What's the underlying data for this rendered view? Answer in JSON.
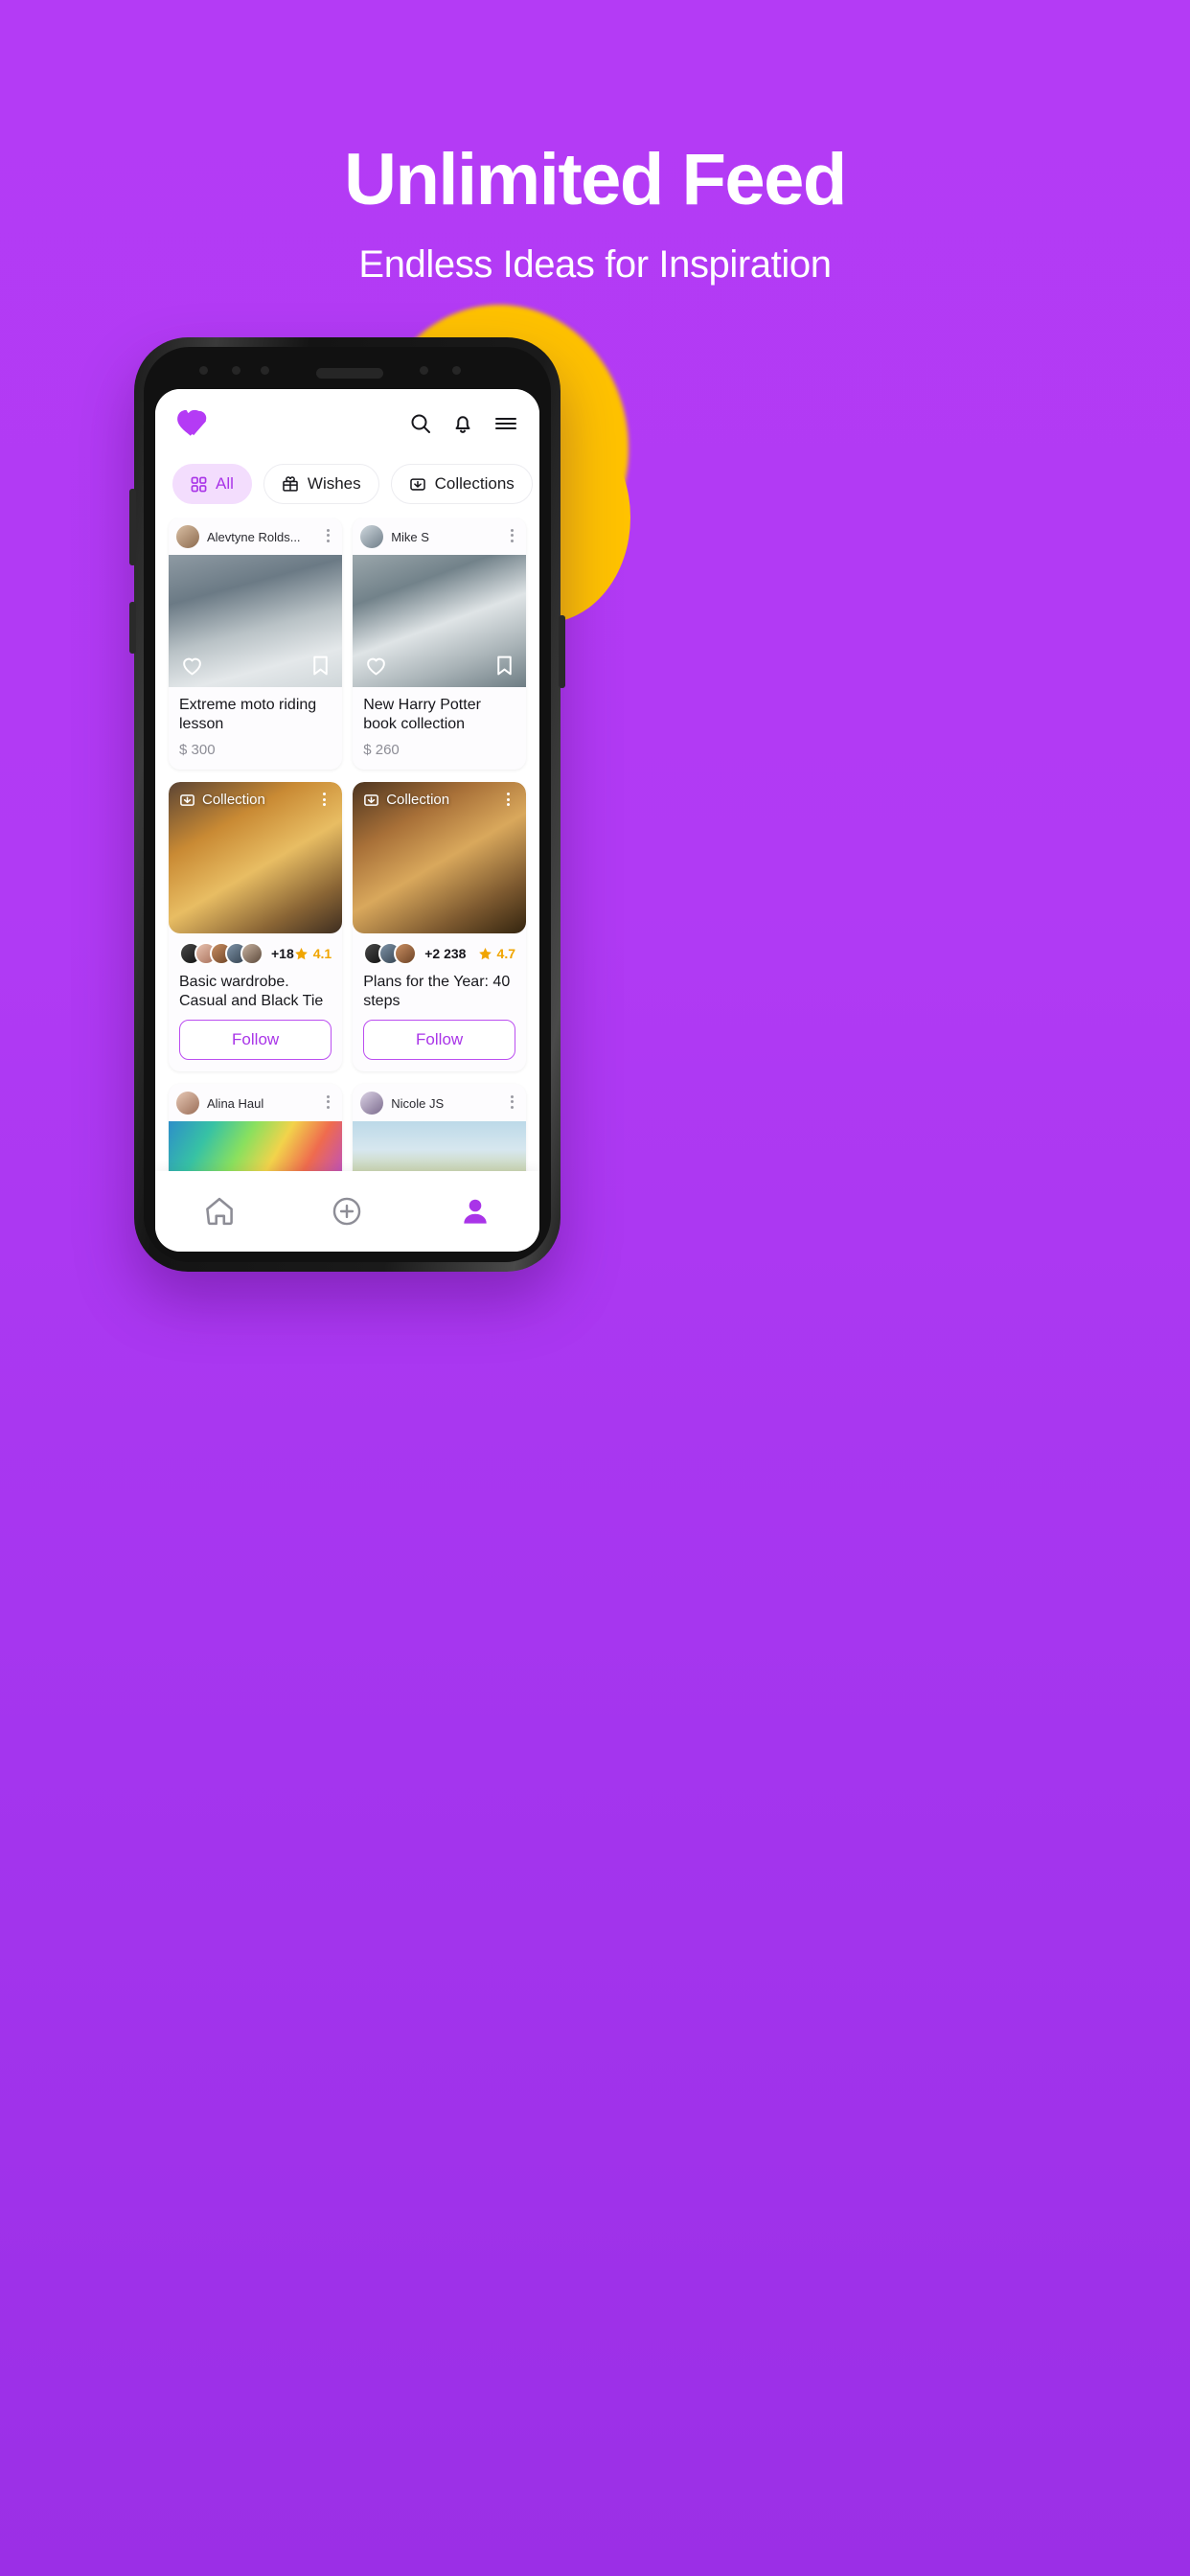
{
  "hero": {
    "title": "Unlimited Feed",
    "subtitle": "Endless Ideas for Inspiration"
  },
  "colors": {
    "background_top": "#b43bf5",
    "background_bottom": "#9b2fe6",
    "accent": "#a934e8",
    "chip_active_bg": "#f3ddfd",
    "blob": "#ffc200",
    "star": "#f0a500",
    "follow_border": "#bb4ef0"
  },
  "app": {
    "header": {
      "logo": "heart-logo",
      "icons": [
        "search-icon",
        "bell-icon",
        "menu-icon"
      ]
    },
    "chips": [
      {
        "label": "All",
        "icon": "grid-icon",
        "active": true
      },
      {
        "label": "Wishes",
        "icon": "gift-icon",
        "active": false
      },
      {
        "label": "Collections",
        "icon": "collection-icon",
        "active": false
      }
    ],
    "feed": {
      "left_column": [
        {
          "type": "post",
          "user": "Alevtyne Rolds...",
          "title": "Extreme moto riding lesson",
          "price": "$ 300",
          "media": "moto-rider-photo",
          "actions": [
            "heart-icon",
            "bookmark-icon"
          ],
          "menu": "more-options-icon"
        },
        {
          "type": "collection",
          "badge": "Collection",
          "badge_icon": "collection-icon",
          "title": "Basic wardrobe. Casual and Black Tie",
          "participants_extra": "+18",
          "rating": "4.1",
          "follow_label": "Follow",
          "media": "man-yellow-hoodie-photo",
          "menu": "more-options-icon"
        },
        {
          "type": "post",
          "user": "Alina Haul",
          "media": "colorful-abstract-photo",
          "menu": "more-options-icon"
        }
      ],
      "right_column": [
        {
          "type": "post",
          "user": "Mike S",
          "title": "New Harry Potter book collection",
          "price": "$ 260",
          "media": "steam-train-viaduct-photo",
          "actions": [
            "heart-icon",
            "bookmark-icon"
          ],
          "menu": "more-options-icon"
        },
        {
          "type": "collection",
          "badge": "Collection",
          "badge_icon": "collection-icon",
          "title": "Plans for the Year: 40 steps",
          "participants_extra": "+2 238",
          "rating": "4.7",
          "follow_label": "Follow",
          "media": "echidna-photo",
          "menu": "more-options-icon"
        },
        {
          "type": "post",
          "user": "Nicole JS",
          "media": "sky-grass-photo",
          "menu": "more-options-icon"
        }
      ]
    },
    "tabbar": [
      {
        "icon": "home-icon",
        "active": false
      },
      {
        "icon": "plus-icon",
        "active": false
      },
      {
        "icon": "profile-icon",
        "active": true
      }
    ]
  }
}
